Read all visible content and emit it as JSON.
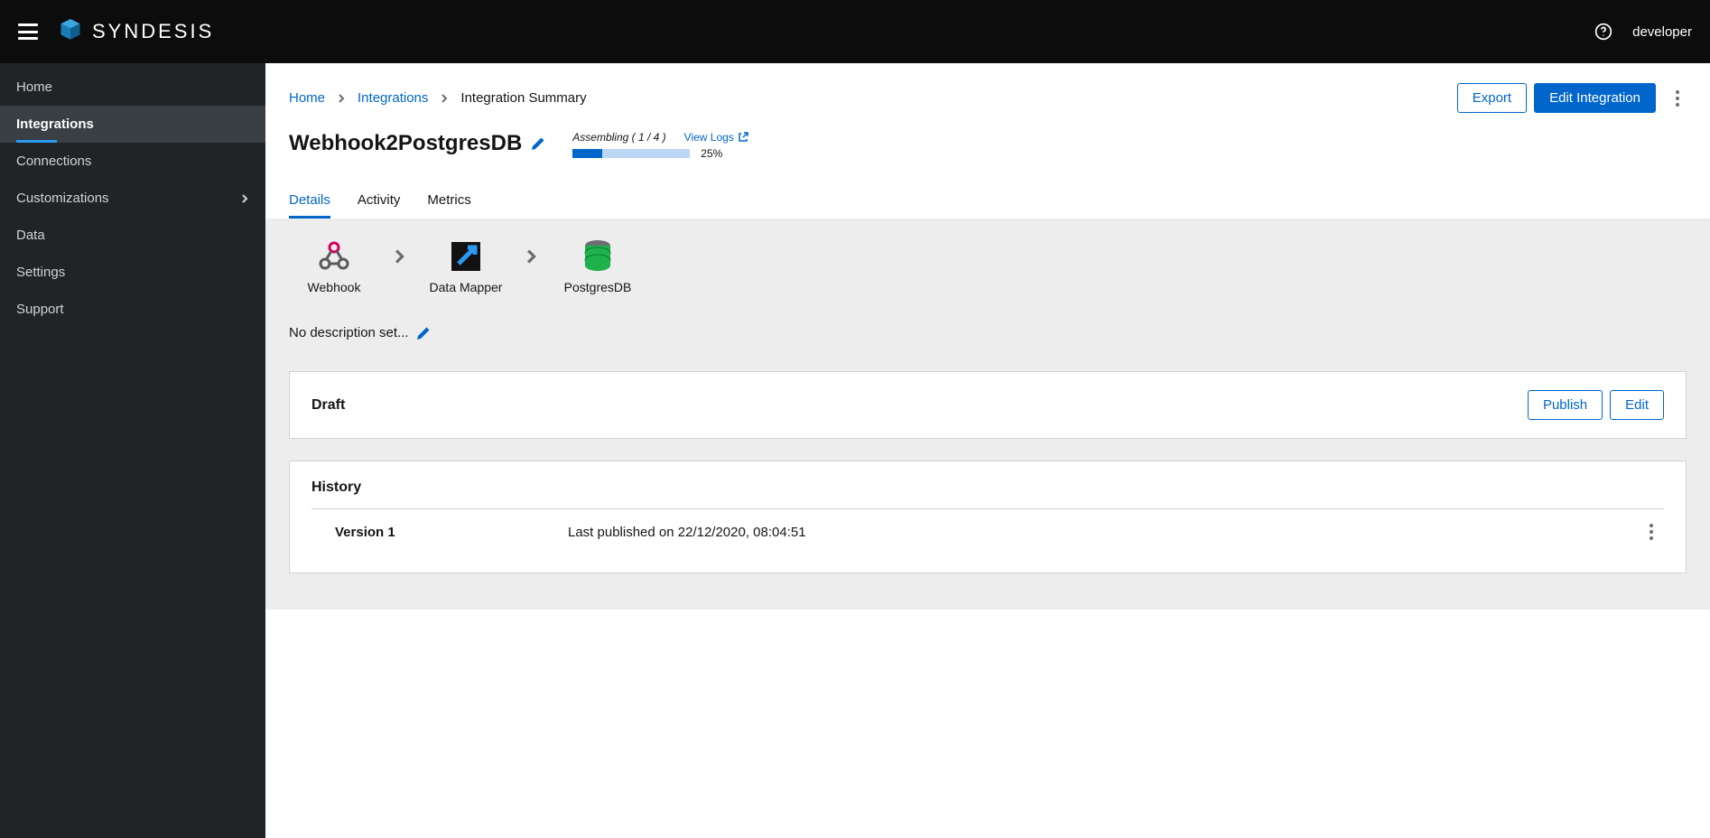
{
  "brand": {
    "name": "SYNDESIS"
  },
  "user": "developer",
  "sidebar": {
    "items": [
      {
        "label": "Home"
      },
      {
        "label": "Integrations"
      },
      {
        "label": "Connections"
      },
      {
        "label": "Customizations"
      },
      {
        "label": "Data"
      },
      {
        "label": "Settings"
      },
      {
        "label": "Support"
      }
    ],
    "activeIndex": 1,
    "expandableIndex": 3
  },
  "breadcrumb": {
    "items": [
      "Home",
      "Integrations",
      "Integration Summary"
    ]
  },
  "header": {
    "export": "Export",
    "edit": "Edit Integration"
  },
  "integration": {
    "name": "Webhook2PostgresDB",
    "status": "Assembling ( 1 / 4 )",
    "viewLogs": "View Logs",
    "progressPct": "25%",
    "progressWidth": 25
  },
  "tabs": [
    "Details",
    "Activity",
    "Metrics"
  ],
  "activeTab": 0,
  "flow": {
    "steps": [
      {
        "label": "Webhook"
      },
      {
        "label": "Data Mapper"
      },
      {
        "label": "PostgresDB"
      }
    ]
  },
  "description": "No description set...",
  "draft": {
    "title": "Draft",
    "publish": "Publish",
    "edit": "Edit"
  },
  "history": {
    "title": "History",
    "items": [
      {
        "version": "Version 1",
        "date": "Last published on 22/12/2020, 08:04:51"
      }
    ]
  }
}
